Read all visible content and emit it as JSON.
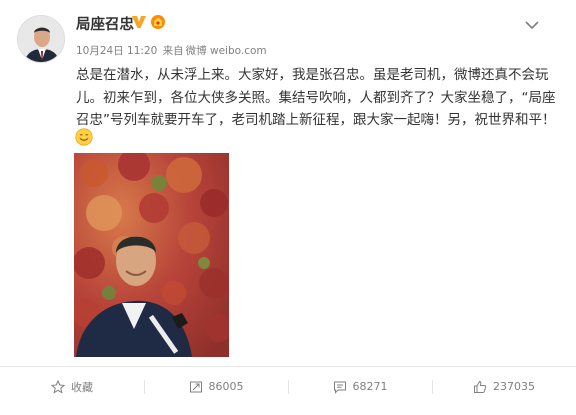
{
  "post": {
    "author": "局座召忠",
    "date": "10月24日 11:20",
    "source_prefix": "来自",
    "source": "微博 weibo.com",
    "text_lines": [
      "总是在潜水，从未浮上来。大家好，我是张召忠。虽是老司机，微博还真不会玩",
      "儿。初来乍到，各位大侠多关照。集结号吹响，人都到齐了？大家坐稳了，“局座",
      "召忠”号列车就要开车了，老司机踏上新征程，跟大家一起嗨！另，祝世界和平！"
    ],
    "emoji": "smile-emoji"
  },
  "actions": {
    "favorite_label": "收藏",
    "repost_count": "86005",
    "comment_count": "68271",
    "like_count": "237035"
  },
  "colors": {
    "verified_badge": "#f5a623",
    "text": "#333333",
    "meta": "#808080"
  }
}
